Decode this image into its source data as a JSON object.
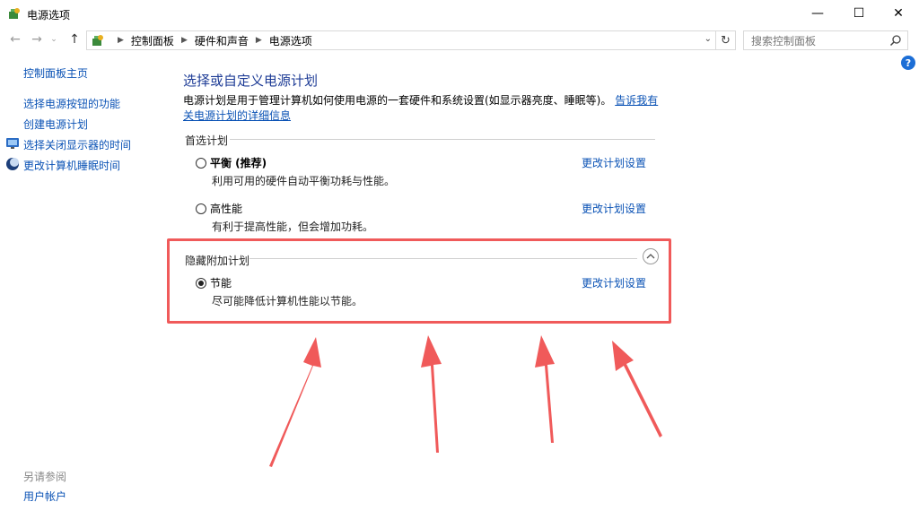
{
  "window": {
    "title": "电源选项",
    "minimize": "—",
    "maximize": "☐",
    "close": "✕"
  },
  "nav": {
    "back": "←",
    "forward": "→",
    "recent": "⌄",
    "up": "↑",
    "breadcrumbs": [
      "控制面板",
      "硬件和声音",
      "电源选项"
    ],
    "refresh": "↻",
    "search_placeholder": "搜索控制面板"
  },
  "help_label": "?",
  "sidebar": {
    "items": [
      {
        "label": "控制面板主页",
        "icon": ""
      },
      {
        "label": "选择电源按钮的功能",
        "icon": ""
      },
      {
        "label": "创建电源计划",
        "icon": ""
      },
      {
        "label": "选择关闭显示器的时间",
        "icon": "monitor-icon"
      },
      {
        "label": "更改计算机睡眠时间",
        "icon": "moon-icon"
      }
    ],
    "see_also_heading": "另请参阅",
    "see_also_items": [
      "用户帐户"
    ]
  },
  "main": {
    "title": "选择或自定义电源计划",
    "description": "电源计划是用于管理计算机如何使用电源的一套硬件和系统设置(如显示器亮度、睡眠等)。",
    "description_link": "告诉我有关电源计划的详细信息",
    "preferred_heading": "首选计划",
    "hidden_heading": "隐藏附加计划",
    "plans": [
      {
        "name": "平衡 (推荐)",
        "desc": "利用可用的硬件自动平衡功耗与性能。",
        "selected": false,
        "link": "更改计划设置"
      },
      {
        "name": "高性能",
        "desc": "有利于提高性能，但会增加功耗。",
        "selected": false,
        "link": "更改计划设置"
      },
      {
        "name": "节能",
        "desc": "尽可能降低计算机性能以节能。",
        "selected": true,
        "link": "更改计划设置"
      }
    ]
  },
  "colors": {
    "link": "#0a52b5",
    "title": "#1e3c96",
    "annotation": "#f05a5a"
  }
}
